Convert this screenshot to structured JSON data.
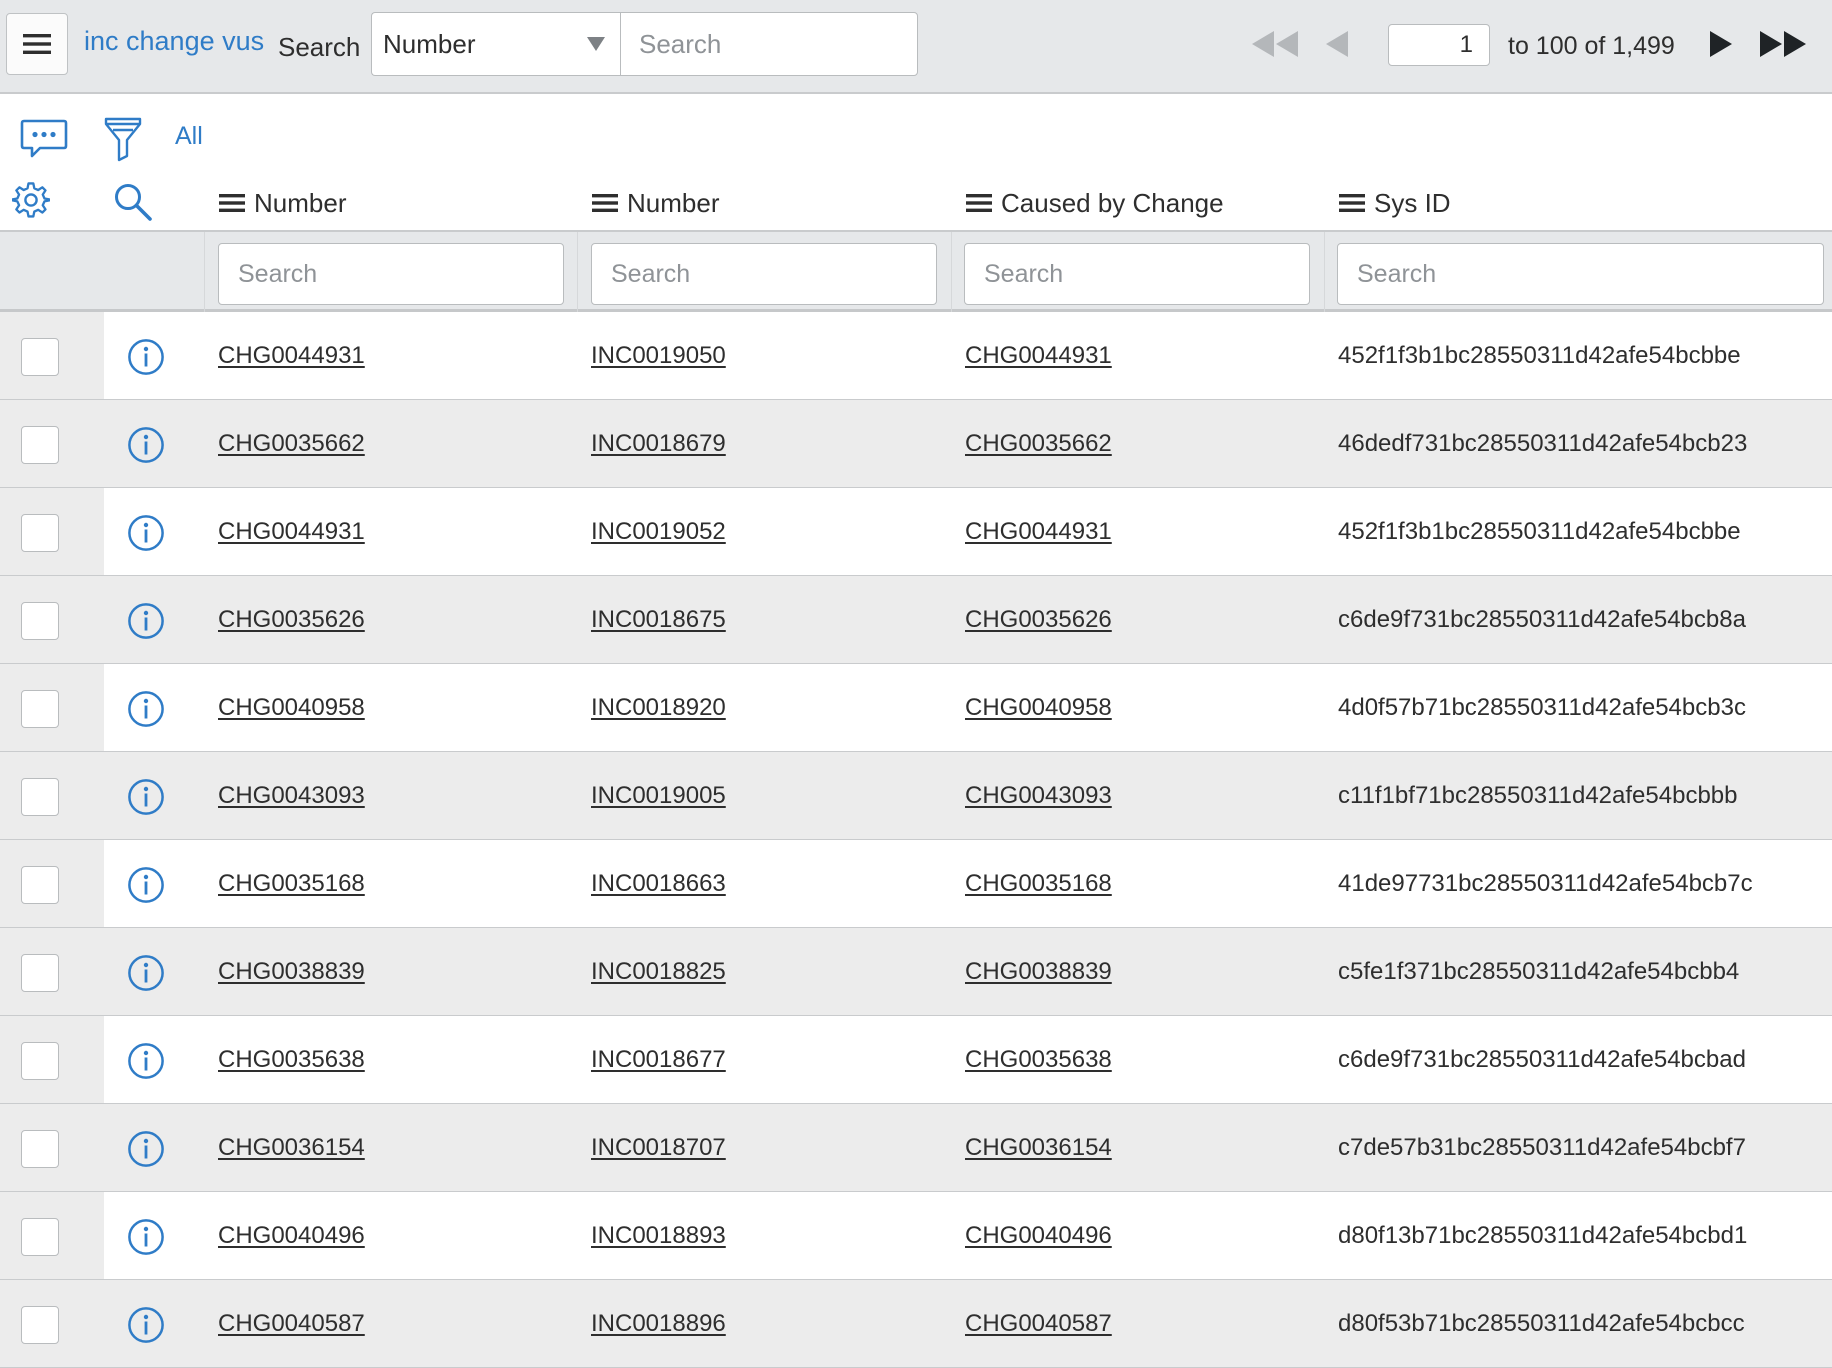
{
  "header": {
    "menu_icon": "hamburger-menu-icon",
    "list_title": "inc change vus",
    "search_label": "Search",
    "field_select_value": "Number",
    "search_placeholder": "Search",
    "page_input_value": "1",
    "page_range": "to 100 of 1,499"
  },
  "toolbar": {
    "filter_all_label": "All"
  },
  "columns": [
    {
      "label": "Number",
      "search_placeholder": "Search"
    },
    {
      "label": "Number",
      "search_placeholder": "Search"
    },
    {
      "label": "Caused by Change",
      "search_placeholder": "Search"
    },
    {
      "label": "Sys ID",
      "search_placeholder": "Search"
    }
  ],
  "rows": [
    {
      "change": "CHG0044931",
      "incident": "INC0019050",
      "caused_by": "CHG0044931",
      "sys_id": "452f1f3b1bc28550311d42afe54bcbbe"
    },
    {
      "change": "CHG0035662",
      "incident": "INC0018679",
      "caused_by": "CHG0035662",
      "sys_id": "46dedf731bc28550311d42afe54bcb23"
    },
    {
      "change": "CHG0044931",
      "incident": "INC0019052",
      "caused_by": "CHG0044931",
      "sys_id": "452f1f3b1bc28550311d42afe54bcbbe"
    },
    {
      "change": "CHG0035626",
      "incident": "INC0018675",
      "caused_by": "CHG0035626",
      "sys_id": "c6de9f731bc28550311d42afe54bcb8a"
    },
    {
      "change": "CHG0040958",
      "incident": "INC0018920",
      "caused_by": "CHG0040958",
      "sys_id": "4d0f57b71bc28550311d42afe54bcb3c"
    },
    {
      "change": "CHG0043093",
      "incident": "INC0019005",
      "caused_by": "CHG0043093",
      "sys_id": "c11f1bf71bc28550311d42afe54bcbbb"
    },
    {
      "change": "CHG0035168",
      "incident": "INC0018663",
      "caused_by": "CHG0035168",
      "sys_id": "41de97731bc28550311d42afe54bcb7c"
    },
    {
      "change": "CHG0038839",
      "incident": "INC0018825",
      "caused_by": "CHG0038839",
      "sys_id": "c5fe1f371bc28550311d42afe54bcbb4"
    },
    {
      "change": "CHG0035638",
      "incident": "INC0018677",
      "caused_by": "CHG0035638",
      "sys_id": "c6de9f731bc28550311d42afe54bcbad"
    },
    {
      "change": "CHG0036154",
      "incident": "INC0018707",
      "caused_by": "CHG0036154",
      "sys_id": "c7de57b31bc28550311d42afe54bcbf7"
    },
    {
      "change": "CHG0040496",
      "incident": "INC0018893",
      "caused_by": "CHG0040496",
      "sys_id": "d80f13b71bc28550311d42afe54bcbd1"
    },
    {
      "change": "CHG0040587",
      "incident": "INC0018896",
      "caused_by": "CHG0040587",
      "sys_id": "d80f53b71bc28550311d42afe54bcbcc"
    }
  ],
  "icons": {
    "activity": "chat-bubble-icon",
    "filter": "funnel-filter-icon",
    "settings": "gear-icon",
    "search": "magnifier-search-icon",
    "row_info": "info-circle-icon",
    "pager_first": "double-left-arrow-icon",
    "pager_prev": "left-arrow-icon",
    "pager_next": "right-arrow-icon",
    "pager_last": "double-right-arrow-icon"
  },
  "colors": {
    "accent_blue": "#2f7cc7",
    "header_bg": "#e6e8ea",
    "alt_row_bg": "#ececec",
    "text": "#2e2e2e"
  }
}
